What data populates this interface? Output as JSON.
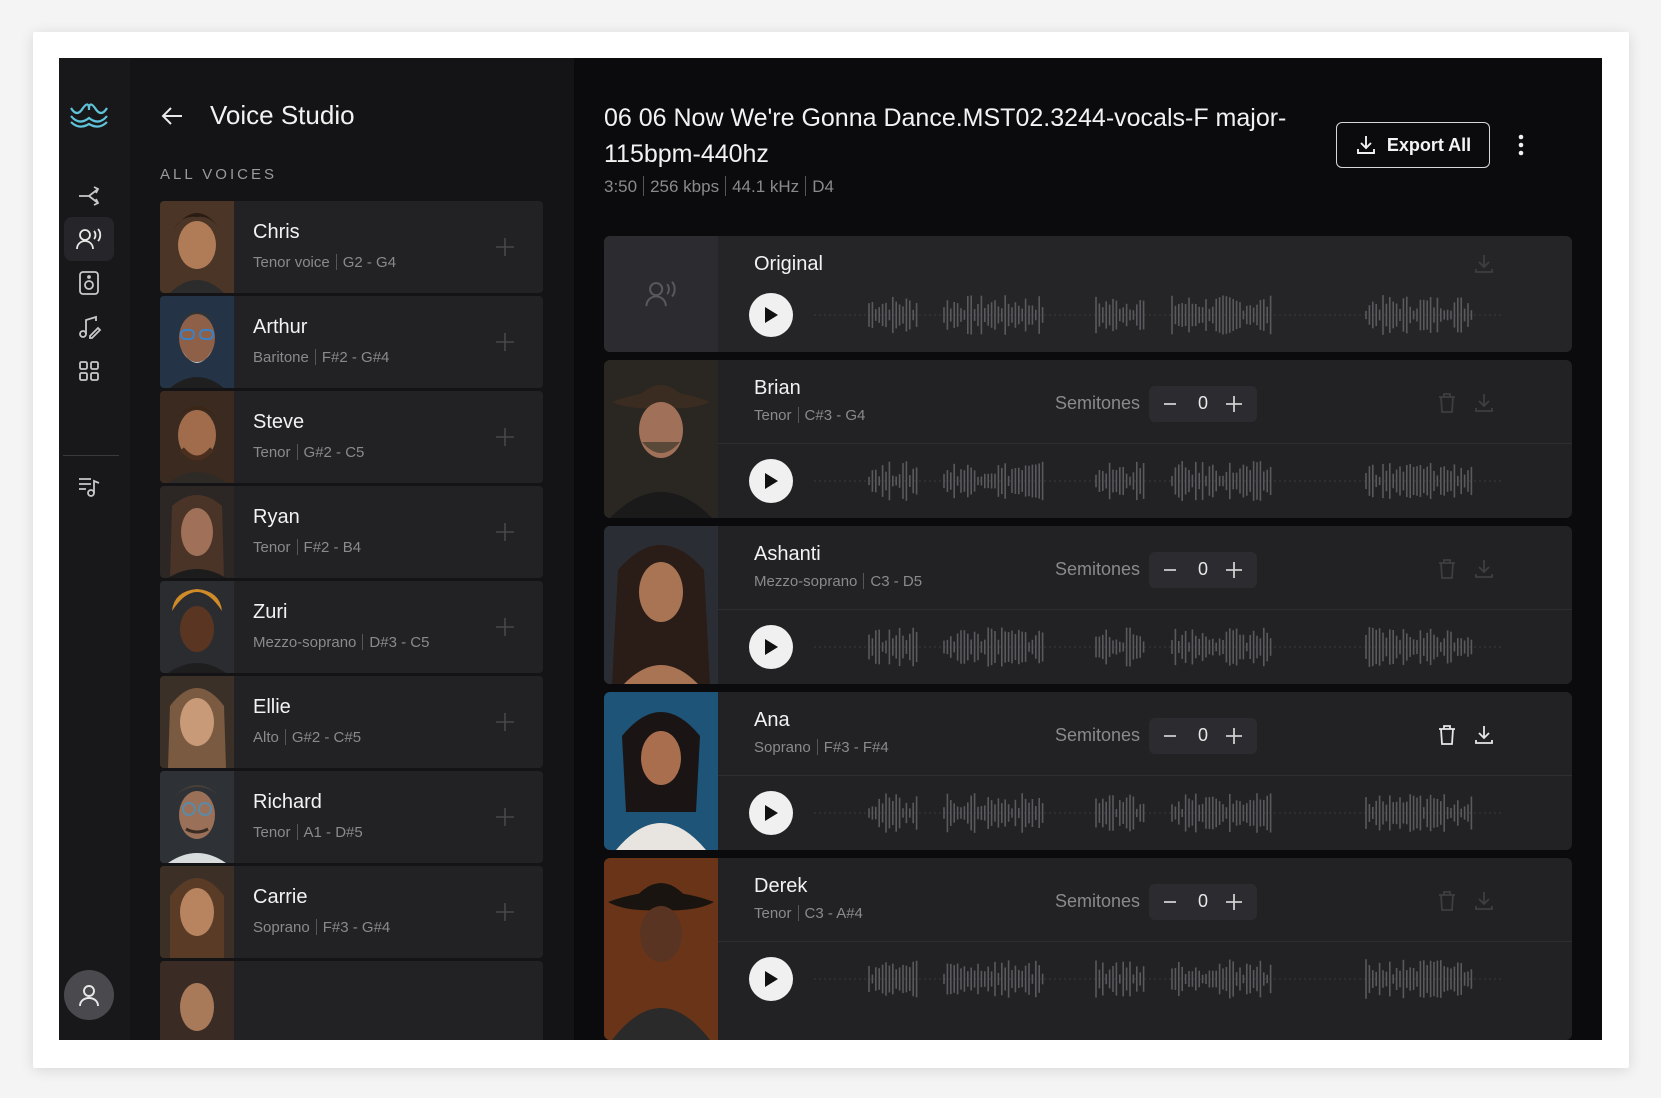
{
  "app": {
    "nav_icons": [
      "waves-logo-icon",
      "split-icon",
      "voice-icon",
      "speaker-icon",
      "music-pen-icon",
      "grid-icon",
      "playlist-icon",
      "user-icon"
    ],
    "colors": {
      "background": "#101012",
      "panel": "#141416",
      "card": "#222225",
      "accent": "#5fc3d9"
    }
  },
  "panel": {
    "title": "Voice Studio",
    "section": "ALL VOICES",
    "voices": [
      {
        "name": "Chris",
        "type": "Tenor voice",
        "range": "G2 - G4"
      },
      {
        "name": "Arthur",
        "type": "Baritone",
        "range": "F#2 - G#4"
      },
      {
        "name": "Steve",
        "type": "Tenor",
        "range": "G#2 - C5"
      },
      {
        "name": "Ryan",
        "type": "Tenor",
        "range": "F#2 - B4"
      },
      {
        "name": "Zuri",
        "type": "Mezzo-soprano",
        "range": "D#3 - C5"
      },
      {
        "name": "Ellie",
        "type": "Alto",
        "range": "G#2 - C#5"
      },
      {
        "name": "Richard",
        "type": "Tenor",
        "range": "A1 - D#5"
      },
      {
        "name": "Carrie",
        "type": "Soprano",
        "range": "F#3 - G#4"
      }
    ]
  },
  "main": {
    "title": "06 06 Now We're Gonna Dance.MST02.3244-vocals-F major-115bpm-440hz",
    "meta": [
      "3:50",
      "256 kbps",
      "44.1 kHz",
      "D4"
    ],
    "export_label": "Export All",
    "original_label": "Original",
    "semitones_label": "Semitones",
    "tracks": [
      {
        "name": "Brian",
        "type": "Tenor",
        "range": "C#3 - G4",
        "semitones": "0"
      },
      {
        "name": "Ashanti",
        "type": "Mezzo-soprano",
        "range": "C3 - D5",
        "semitones": "0"
      },
      {
        "name": "Ana",
        "type": "Soprano",
        "range": "F#3 - F#4",
        "semitones": "0"
      },
      {
        "name": "Derek",
        "type": "Tenor",
        "range": "C3 - A#4",
        "semitones": "0"
      }
    ]
  }
}
